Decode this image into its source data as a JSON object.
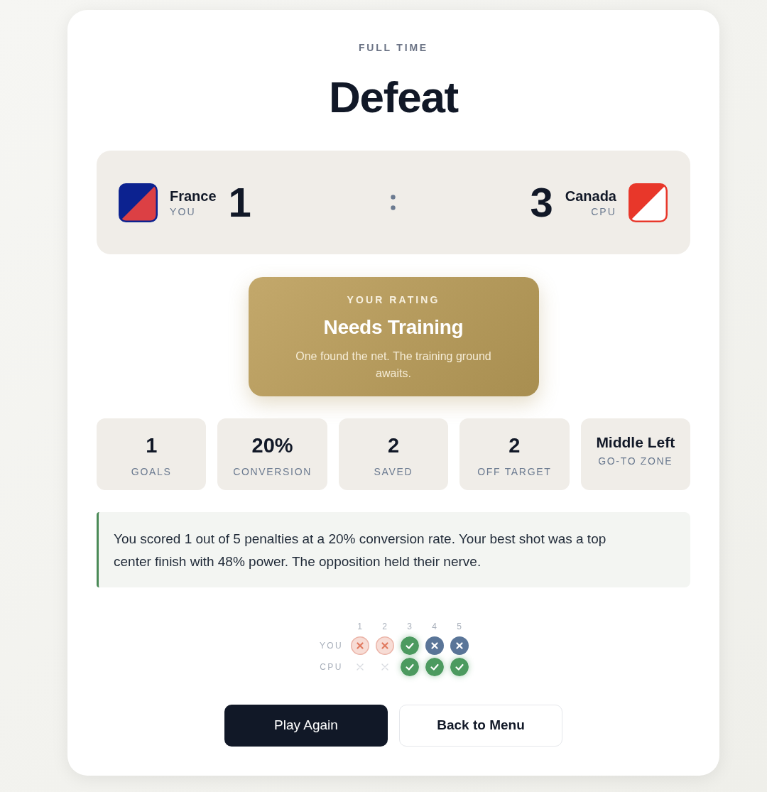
{
  "header": {
    "eyebrow": "FULL TIME",
    "result": "Defeat"
  },
  "scoreboard": {
    "teams": [
      {
        "name": "France",
        "tag": "YOU",
        "score": "1",
        "flag": [
          {
            "color": "#0c2290"
          },
          {
            "color": "#dc4044"
          }
        ]
      },
      {
        "name": "Canada",
        "tag": "CPU",
        "score": "3",
        "flag": [
          {
            "color": "#e8372a"
          },
          {
            "color": "#ffffff"
          }
        ]
      }
    ]
  },
  "rating": {
    "eyebrow": "YOUR RATING",
    "title": "Needs Training",
    "description": "One found the net. The training ground awaits."
  },
  "stats": [
    {
      "kind": "number",
      "value": "1",
      "label": "GOALS"
    },
    {
      "kind": "number",
      "value": "20%",
      "label": "CONVERSION"
    },
    {
      "kind": "number",
      "value": "2",
      "label": "SAVED"
    },
    {
      "kind": "number",
      "value": "2",
      "label": "OFF TARGET"
    },
    {
      "kind": "text",
      "value": "Middle Left",
      "label": "GO-TO ZONE"
    }
  ],
  "summary": {
    "text": "You scored 1 out of 5 penalties at a 20% conversion rate. Your best shot was a top center finish with 48% power. The opposition held their nerve."
  },
  "shootout": {
    "columns": [
      "1",
      "2",
      "3",
      "4",
      "5"
    ],
    "rows": [
      {
        "label": "YOU",
        "kicks": [
          {
            "kind": "miss"
          },
          {
            "kind": "miss"
          },
          {
            "kind": "goal"
          },
          {
            "kind": "saved"
          },
          {
            "kind": "saved"
          }
        ]
      },
      {
        "label": "CPU",
        "kicks": [
          {
            "kind": "pending"
          },
          {
            "kind": "pending"
          },
          {
            "kind": "goal"
          },
          {
            "kind": "goal"
          },
          {
            "kind": "goal"
          }
        ]
      }
    ]
  },
  "buttons": [
    {
      "kind": "primary",
      "label": "Play Again"
    },
    {
      "kind": "secondary",
      "label": "Back to Menu"
    }
  ]
}
